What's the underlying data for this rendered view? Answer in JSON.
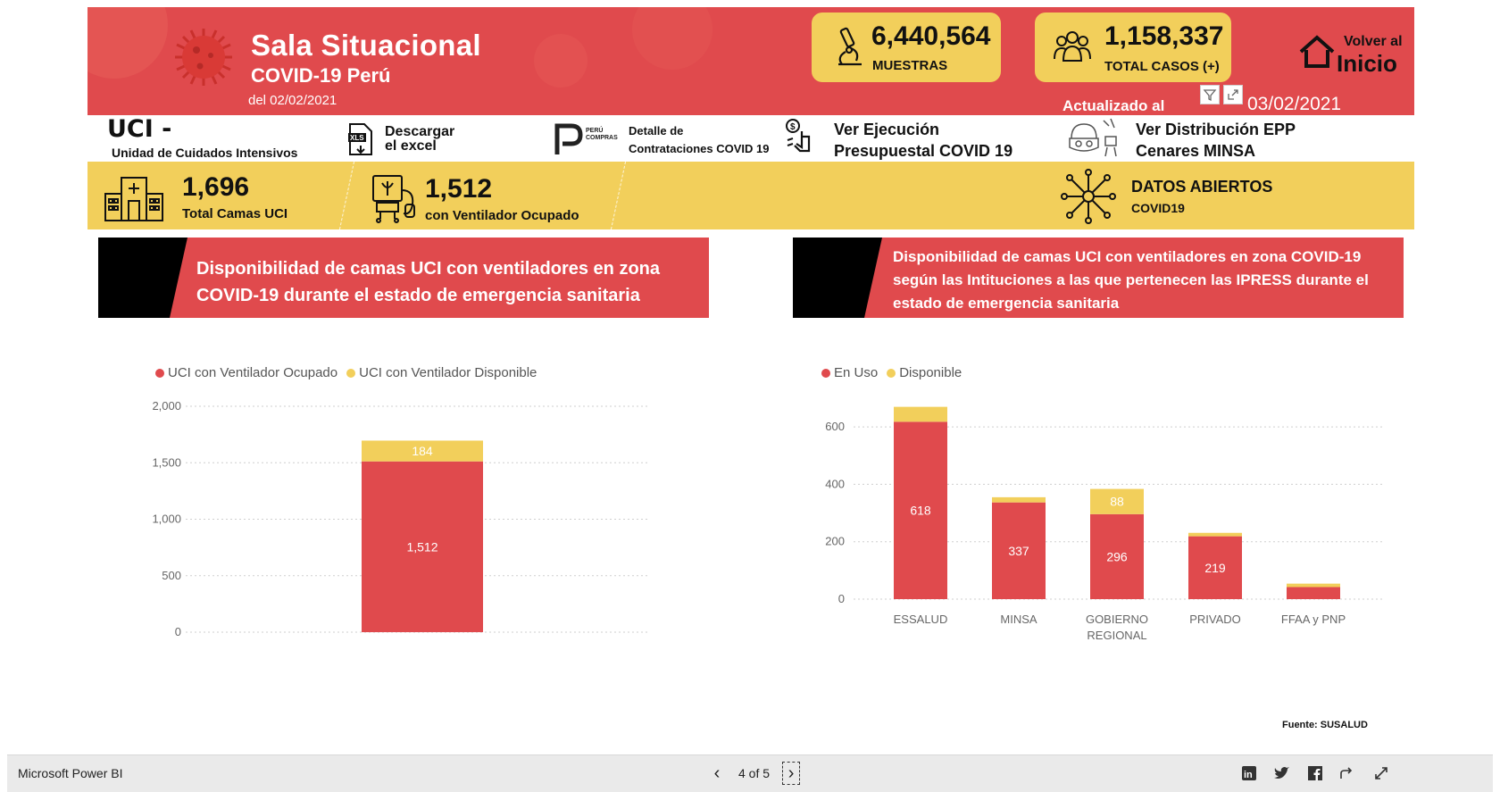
{
  "header": {
    "title": "Sala Situacional",
    "subtitle": "COVID-19 Perú",
    "date": "del 02/02/2021",
    "updated_label": "Actualizado al",
    "updated_date": "03/02/2021",
    "home_line1": "Volver al",
    "home_line2": "Inicio"
  },
  "kpis": {
    "muestras": {
      "value": "6,440,564",
      "label": "MUESTRAS",
      "icon": "microscope-icon"
    },
    "casos": {
      "value": "1,158,337",
      "label": "TOTAL CASOS (+)",
      "icon": "people-group-icon"
    }
  },
  "links": {
    "uci_title": "UCI  -",
    "uci_sub": "Unidad de Cuidados Intensivos",
    "excel_1": "Descargar",
    "excel_2": "el excel",
    "compras_logo_1": "PERÚ",
    "compras_logo_2": "COMPRAS",
    "compras_1": "Detalle  de",
    "compras_2": "Contrataciones COVID 19",
    "presupuesto_1": "Ver Ejecución",
    "presupuesto_2": "Presupuestal COVID 19",
    "epp_1": "Ver Distribución EPP",
    "epp_2": "Cenares MINSA"
  },
  "band": {
    "camas_value": "1,696",
    "camas_label": "Total Camas UCI",
    "vent_value": "1,512",
    "vent_label": "con Ventilador Ocupado",
    "datos_1": "DATOS ABIERTOS",
    "datos_2": "COVID19"
  },
  "section_left": {
    "title": "Disponibilidad  de camas UCI con ventiladores en zona COVID-19 durante el estado de emergencia sanitaria",
    "legend": [
      "UCI con Ventilador Ocupado",
      "UCI con Ventilador Disponible"
    ]
  },
  "section_right": {
    "title": "Disponibilidad de camas UCI con ventiladores en zona COVID-19 según las Intituciones a las que pertenecen las IPRESS durante el estado de emergencia sanitaria",
    "legend": [
      "En Uso",
      "Disponible"
    ],
    "source": "Fuente: SUSALUD"
  },
  "colors": {
    "red": "#e04a4d",
    "yellow": "#f2cf5b",
    "black": "#000000"
  },
  "chart_data": [
    {
      "type": "bar",
      "stacked": true,
      "categories": [
        ""
      ],
      "series": [
        {
          "name": "UCI con Ventilador Ocupado",
          "values": [
            1512
          ],
          "labels": [
            "1,512"
          ],
          "color": "#e04a4d"
        },
        {
          "name": "UCI con Ventilador Disponible",
          "values": [
            184
          ],
          "labels": [
            "184"
          ],
          "color": "#f2cf5b"
        }
      ],
      "ylim": [
        0,
        2000
      ],
      "yticks": [
        "0",
        "500",
        "1,000",
        "1,500",
        "2,000"
      ],
      "yvals": [
        0,
        500,
        1000,
        1500,
        2000
      ],
      "legend_position": "top-left",
      "grid": true
    },
    {
      "type": "bar",
      "stacked": true,
      "categories": [
        "ESSALUD",
        "MINSA",
        "GOBIERNO REGIONAL",
        "PRIVADO",
        "FFAA y PNP"
      ],
      "series": [
        {
          "name": "En Uso",
          "values": [
            618,
            337,
            296,
            219,
            42
          ],
          "labels": [
            "618",
            "337",
            "296",
            "219",
            ""
          ],
          "color": "#e04a4d"
        },
        {
          "name": "Disponible",
          "values": [
            52,
            18,
            88,
            12,
            12
          ],
          "labels": [
            "",
            "",
            "88",
            "",
            ""
          ],
          "color": "#f2cf5b"
        }
      ],
      "ylim": [
        0,
        700
      ],
      "yticks": [
        "0",
        "200",
        "400",
        "600"
      ],
      "yvals": [
        0,
        200,
        400,
        600
      ],
      "legend_position": "top-left",
      "grid": true
    }
  ],
  "footer": {
    "brand": "Microsoft Power BI",
    "page": "4 of 5",
    "prev": "‹",
    "next": "›"
  }
}
